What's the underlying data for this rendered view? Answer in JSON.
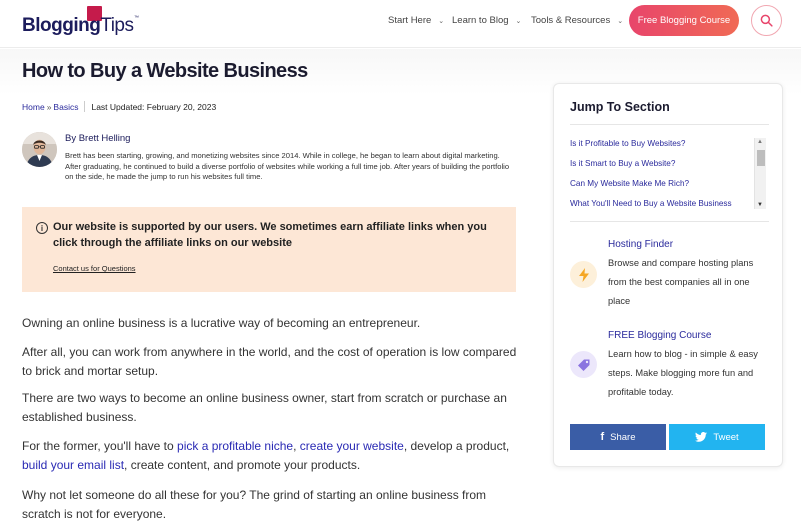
{
  "header": {
    "logo": {
      "bold": "Blogging",
      "light": "Tips",
      "tm": "™"
    },
    "nav": [
      "Start Here",
      "Learn to Blog",
      "Tools & Resources"
    ],
    "cta": "Free Blogging Course",
    "icons": {
      "search": "search-icon",
      "chevron": "chevron-down-icon"
    },
    "accent_color": "#e8456b"
  },
  "article": {
    "title": "How to Buy a Website Business",
    "breadcrumb": {
      "home": "Home",
      "sep": "»",
      "category": "Basics"
    },
    "updated": "Last Updated: February 20, 2023",
    "author": {
      "name": "By Brett Helling",
      "bio": "Brett has been starting, growing, and monetizing websites since 2014. While in college, he began to learn about digital marketing. After graduating, he continued to build a diverse portfolio of websites while working a full time job. After years of building the portfolio on the side, he made the jump to run his websites full time."
    },
    "notice": {
      "text": "Our website is supported by our users. We sometimes earn affiliate links when you click through the affiliate links on our website",
      "link": "Contact us for Questions",
      "icon": "info-icon",
      "bg_color": "#fde7d6"
    },
    "paragraphs": {
      "p1": "Owning an online business is a lucrative way of becoming an entrepreneur.",
      "p2": "After all, you can work from anywhere in the world, and the cost of operation is low compared to brick and mortar setup.",
      "p3": "There are two ways to become an online business owner, start from scratch or purchase an established business.",
      "p4": {
        "t1": "For the former, you'll have to ",
        "l1": "pick a profitable niche",
        "t2": ", ",
        "l2": "create your website",
        "t3": ", develop a product, ",
        "l3": "build your email list",
        "t4": ", create content, and promote your products."
      },
      "p5": "Why not let someone do all these for you? The grind of starting an online business from scratch is not for everyone."
    }
  },
  "sidebar": {
    "title": "Jump To Section",
    "toc": [
      "Is it Profitable to Buy Websites?",
      "Is it Smart to Buy a Website?",
      "Can My Website Make Me Rich?",
      "What You'll Need to Buy a Website Business"
    ],
    "promos": [
      {
        "title": "Hosting Finder",
        "desc": "Browse and compare hosting plans from the best companies all in one place",
        "icon": "lightning-icon",
        "color": "#f5a623"
      },
      {
        "title": "FREE Blogging Course",
        "desc": "Learn how to blog - in simple & easy steps. Make blogging more fun and profitable today.",
        "icon": "tag-icon",
        "color": "#8a73e0"
      }
    ],
    "share": {
      "facebook": "Share",
      "twitter": "Tweet",
      "facebook_color": "#3a5da6",
      "twitter_color": "#22b4f0"
    }
  }
}
